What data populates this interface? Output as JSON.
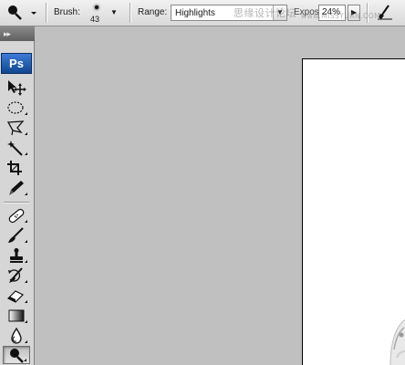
{
  "options_bar": {
    "brush_label": "Brush:",
    "brush_size": "43",
    "range_label": "Range:",
    "range_value": "Highlights",
    "exposure_label": "Exposure:",
    "exposure_value": "24%"
  },
  "watermark": {
    "text": "思缘设计论坛",
    "url": "www.MISSYUAN.COM"
  },
  "toolbox": {
    "logo": "Ps",
    "tools": [
      {
        "name": "move-tool-icon"
      },
      {
        "name": "elliptical-marquee-tool-icon"
      },
      {
        "name": "polygonal-lasso-tool-icon"
      },
      {
        "name": "magic-wand-tool-icon"
      },
      {
        "name": "crop-tool-icon"
      },
      {
        "name": "slice-tool-icon"
      },
      {
        "name": "healing-brush-tool-icon"
      },
      {
        "name": "brush-tool-icon"
      },
      {
        "name": "clone-stamp-tool-icon"
      },
      {
        "name": "history-brush-tool-icon"
      },
      {
        "name": "eraser-tool-icon"
      },
      {
        "name": "gradient-tool-icon"
      },
      {
        "name": "blur-tool-icon"
      },
      {
        "name": "dodge-tool-icon"
      }
    ],
    "selected_tool": "dodge-tool-icon"
  }
}
